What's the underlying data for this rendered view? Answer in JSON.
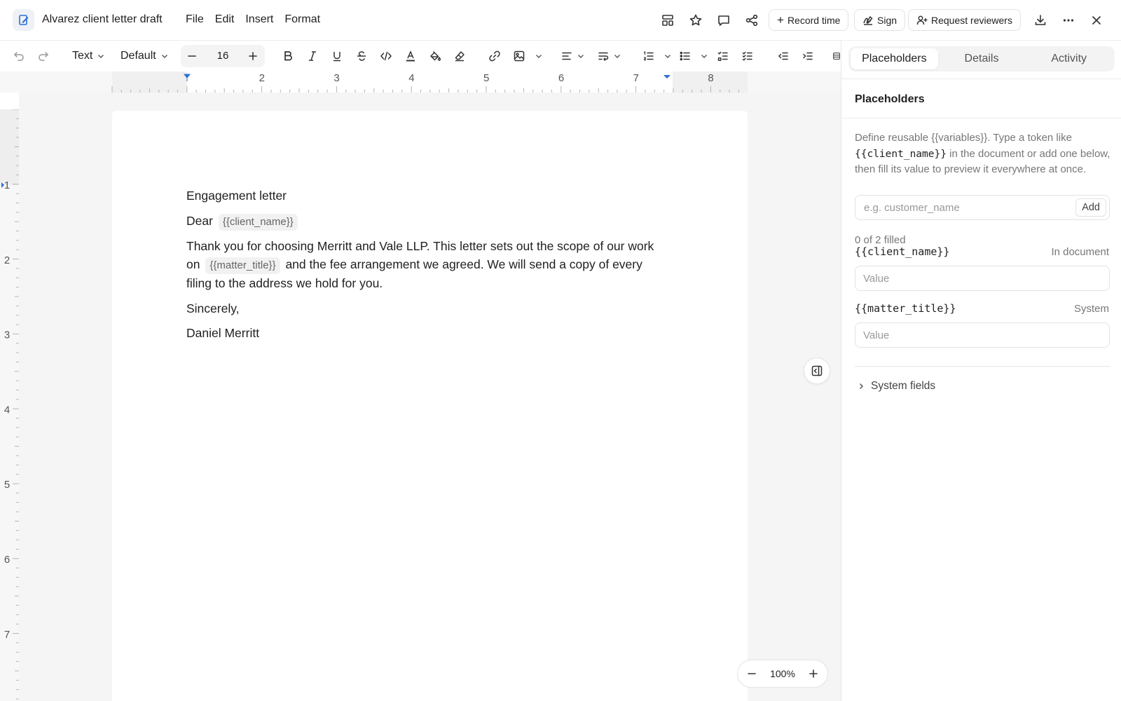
{
  "app": {
    "title": "Alvarez client letter draft",
    "icon": "document-edit-icon",
    "menu": [
      "File",
      "Edit",
      "Insert",
      "Format"
    ]
  },
  "header_actions": {
    "record_time": "Record time",
    "sign": "Sign",
    "request_reviewers": "Request reviewers",
    "icons": [
      "template-icon",
      "star-icon",
      "comment-icon",
      "share-icon",
      "download-icon",
      "more-icon",
      "close-icon"
    ]
  },
  "toolbar": {
    "block_style": "Text",
    "font": "Default",
    "font_size": "16"
  },
  "ruler": {
    "h_labels": [
      "2",
      "3",
      "4",
      "5",
      "6",
      "7",
      "8"
    ],
    "v_labels": [
      "1",
      "2",
      "3",
      "4",
      "5",
      "6",
      "7"
    ]
  },
  "document": {
    "heading": "Engagement letter",
    "salutation": "Dear",
    "token_client": "{{client_name}}",
    "body_part1": "Thank you for choosing Merritt and Vale LLP. This letter sets out the scope of our work on",
    "token_matter": "{{matter_title}}",
    "body_part2": "and the fee arrangement we agreed. We will send a copy of every filing to the address we hold for you.",
    "closing": "Sincerely,",
    "signature": "Daniel Merritt"
  },
  "zoom": {
    "level": "100%"
  },
  "panel": {
    "tabs": [
      "Placeholders",
      "Details",
      "Activity"
    ],
    "active_tab": "Placeholders",
    "heading": "Placeholders",
    "desc_part1": "Define reusable {{variables}}. Type a token like",
    "desc_token": "{{client_name}}",
    "desc_part2": "in the document or add one below, then fill its value to preview it everywhere at once.",
    "add_placeholder": "e.g. customer_name",
    "add_label": "Add",
    "filled_status": "0 of 2 filled",
    "placeholders": [
      {
        "token": "{{client_name}}",
        "source": "In document",
        "value_placeholder": "Value"
      },
      {
        "token": "{{matter_title}}",
        "source": "System",
        "value_placeholder": "Value"
      }
    ],
    "system_fields": "System fields"
  },
  "colors": {
    "accent": "#2f6fd6",
    "text": "#1f1f1f",
    "muted": "#777777"
  }
}
